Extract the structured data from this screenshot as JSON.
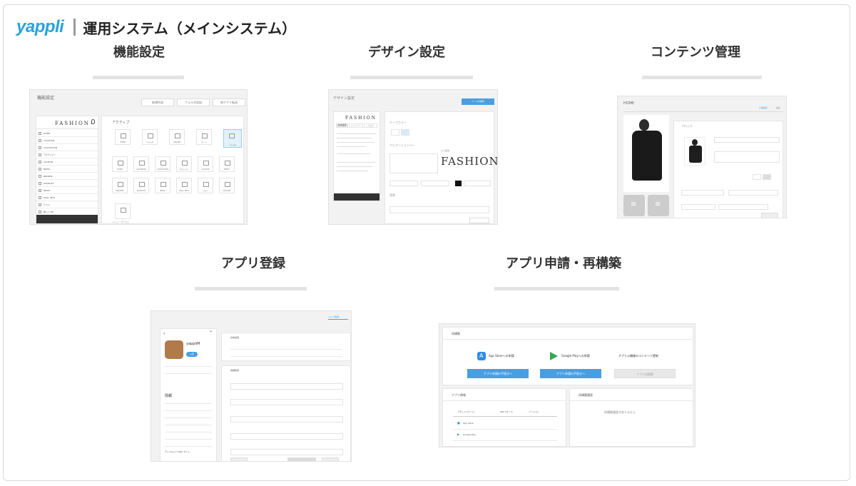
{
  "header": {
    "logo": "yappli",
    "title": "運用システム（メインシステム）"
  },
  "sections": {
    "func": "機能設定",
    "design": "デザイン設定",
    "content": "コンテンツ管理",
    "appreg": "アプリ登録",
    "apply": "アプリ申請・再構築"
  },
  "func_shot": {
    "title": "機能設定",
    "buttons": [
      "新規作成",
      "フォルダ追加",
      "他アプリ転送"
    ],
    "phone_brand": "FASHION",
    "menu": [
      "HOME",
      "LOCATION",
      "COLLECTION",
      "アクティビー",
      "COUPON",
      "NEWS",
      "BRANDS",
      "SHOPLIST",
      "NEWS",
      "MALL INFO",
      "テスト",
      "新しい HP"
    ],
    "panel_title": "アクティブ",
    "tiles": [
      "HOME",
      "フォルダ",
      "ATELIER",
      "カード",
      "フォルダ",
      "HOME",
      "CALENDAR",
      "COLLECTION",
      "アクティビー",
      "COUPON",
      "NEWS",
      "BRANDS",
      "SHOPLIST",
      "NEWS",
      "MALL INFO",
      "テスト",
      "GALLERY"
    ],
    "extra": "メニューカテゴリ"
  },
  "design_shot": {
    "title": "デザイン設定",
    "save": "ページを保存",
    "tabs": [
      "基本設定",
      "メインバー",
      "ブログ"
    ],
    "brand": "FASHION",
    "label_theme": "テーマカラー",
    "label_header": "ナビゲーションバー",
    "label_logo": "ロゴ画像",
    "label_back": "背景"
  },
  "content_shot": {
    "title": "HOME",
    "tab1": "公開設定",
    "tab2": "編集",
    "panel": "ブロック"
  },
  "appreg_shot": {
    "top_link": "ヘルプ情報",
    "app_name": "yappliM",
    "badge": "入手",
    "info": "情報",
    "section1": "基本情報",
    "section2": "詳細情報",
    "developer": "ディベロッパ Web サイト"
  },
  "apply_shot": {
    "rebuild": "再構築",
    "app_store": "App Storeへの申請",
    "google_play": "Google Playへの申請",
    "content_update": "アプリ公開後のコンテンツ更新",
    "btn1": "アプリ申請の手続きへ",
    "btn2": "アプリ申請の手続きへ",
    "btn3": "アプリ再構築",
    "app_info": "アプリ情報",
    "history": "再構築履歴",
    "cols": [
      "プラットフォーム",
      "URLスキーム",
      "バージョン"
    ],
    "rows": [
      "App Store",
      "Google Play"
    ],
    "no_history": "再構築履歴がありません"
  }
}
